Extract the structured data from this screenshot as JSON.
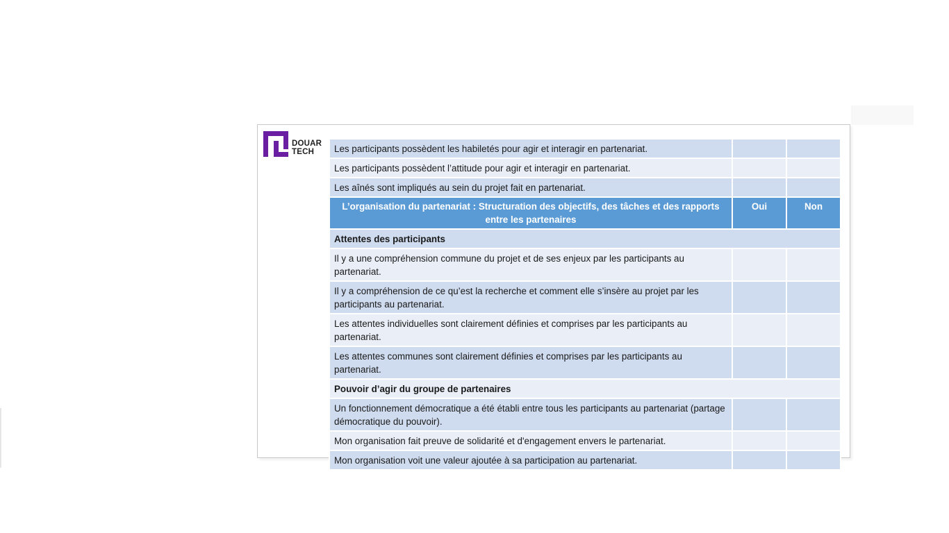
{
  "logo": {
    "text_line1": "DOUAR",
    "text_line2": "TECH",
    "color": "#6a1fa3"
  },
  "table": {
    "rows_top": [
      {
        "text": "Les participants possèdent les habiletés pour agir et interagir en partenariat."
      },
      {
        "text": "Les participants possèdent l’attitude pour agir et interagir en partenariat."
      },
      {
        "text": "Les aînés sont impliqués au sein du projet fait en partenariat."
      }
    ],
    "header": {
      "title": "L’organisation du partenariat : Structuration des objectifs, des tâches et des rapports entre les partenaires",
      "col_yes": "Oui",
      "col_no": "Non"
    },
    "section1": {
      "title": "Attentes des participants",
      "rows": [
        {
          "text": "Il y a une compréhension commune du projet et de ses enjeux par les participants au partenariat."
        },
        {
          "text": "Il y a compréhension de ce qu’est la recherche et comment elle s’insère au projet par les participants au partenariat."
        },
        {
          "text": "Les attentes individuelles sont clairement définies et comprises par les participants au partenariat."
        },
        {
          "text": "Les attentes communes sont clairement définies et comprises par les participants au partenariat."
        }
      ]
    },
    "section2": {
      "title": "Pouvoir d’agir du groupe de partenaires",
      "rows": [
        {
          "text": "Un fonctionnement démocratique a été établi entre tous les participants au partenariat (partage démocratique du pouvoir)."
        },
        {
          "text": "Mon organisation fait preuve de solidarité et d'engagement envers le partenariat."
        },
        {
          "text": "Mon organisation voit une valeur ajoutée à sa participation au partenariat."
        }
      ]
    }
  },
  "colors": {
    "header_blue": "#5b9bd5",
    "row_dark": "#cfdbee",
    "row_light": "#e9eef7"
  }
}
